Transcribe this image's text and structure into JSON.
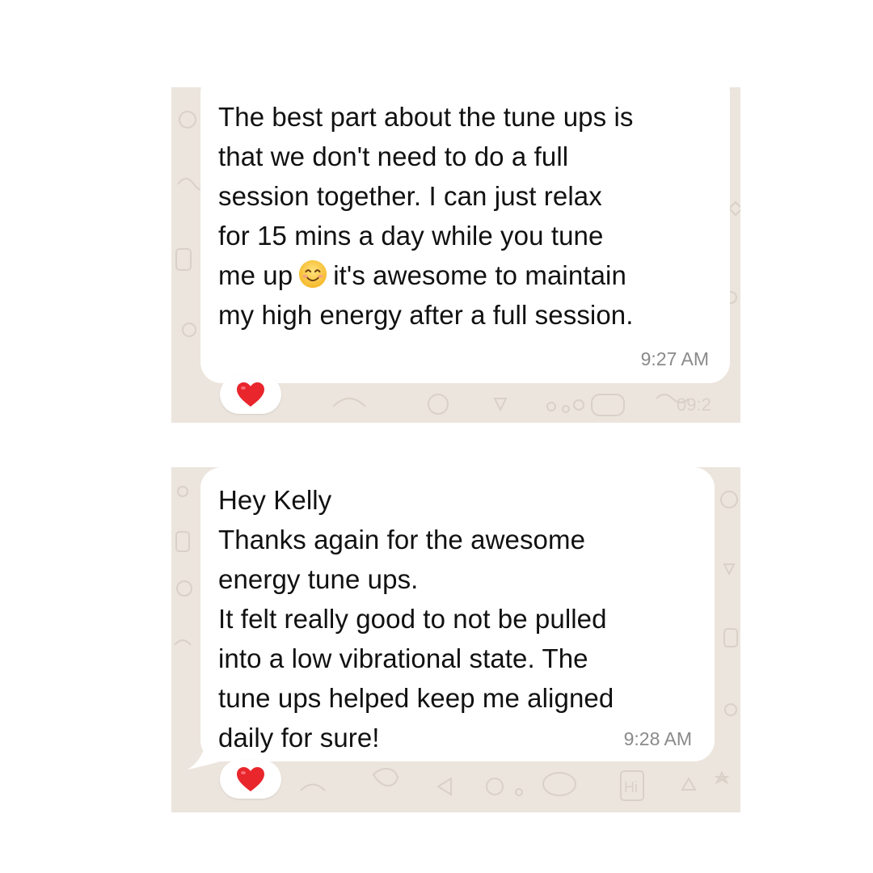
{
  "colors": {
    "chat_background": "#ece5dd",
    "bubble": "#ffffff",
    "timestamp": "#8a8a8a",
    "heart": "#e8262c"
  },
  "messages": [
    {
      "lines": [
        "The best part about the tune ups is",
        "that we don't need to do a full",
        "session together. I can just relax",
        "for 15 mins a day while you tune"
      ],
      "emoji_line_before": "me up",
      "emoji": "smiling-face-with-smiling-eyes",
      "emoji_line_after": "it's awesome to maintain",
      "lines_after": [
        "my high energy after a full session."
      ],
      "time": "9:27 AM",
      "reaction": "heart"
    },
    {
      "lines": [
        "Hey Kelly",
        "Thanks again for the awesome",
        "energy tune ups.",
        "It felt really good to not be pulled",
        "into a low vibrational state. The",
        "tune ups helped keep me aligned",
        "daily for sure!"
      ],
      "time": "9:28 AM",
      "reaction": "heart"
    }
  ]
}
